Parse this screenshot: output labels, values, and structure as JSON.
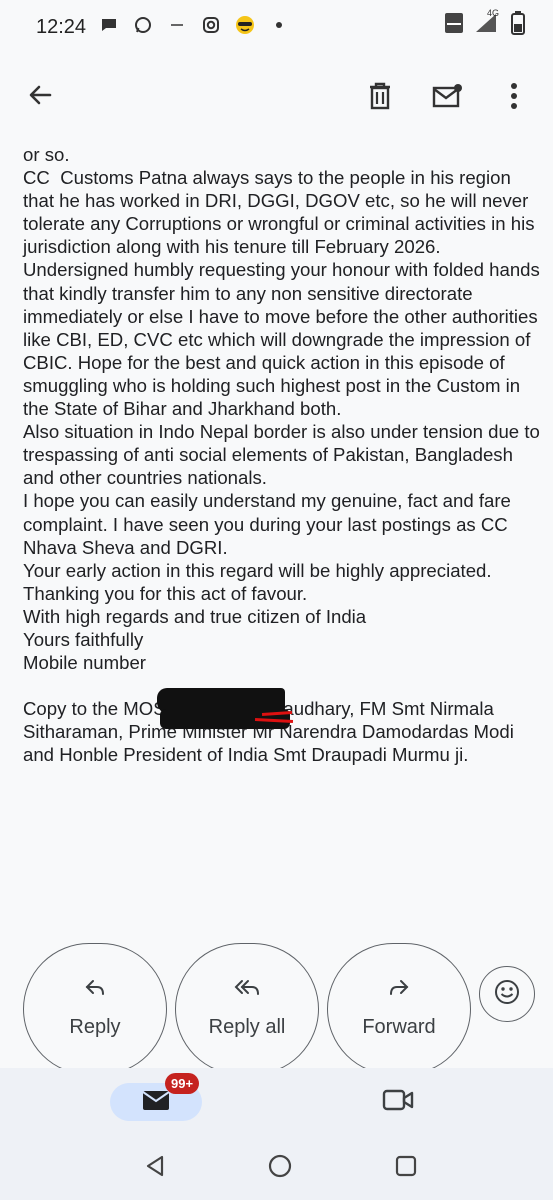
{
  "status_bar": {
    "time": "12:24",
    "left_icons": [
      "chat-bubble-icon",
      "whatsapp-icon",
      "dash-icon",
      "instagram-icon",
      "emoji-sunglasses-icon",
      "dot-icon"
    ],
    "right_icons": [
      "volte-icon",
      "signal-4g-icon",
      "battery-icon"
    ],
    "network_label": "4G"
  },
  "app_bar": {
    "icons": [
      "back-arrow-icon",
      "delete-icon",
      "mark-unread-icon",
      "more-vert-icon"
    ]
  },
  "email": {
    "lines": [
      "or so.",
      "CC  Customs Patna always says to the people in his region that he has worked in DRI, DGGI, DGOV etc, so he will never tolerate any Corruptions or wrongful or criminal activities in his jurisdiction along with his tenure till February 2026.",
      "Undersigned humbly requesting your honour with folded hands that kindly transfer him to any non sensitive directorate immediately or else I have to move before the other authorities like CBI, ED, CVC etc which will downgrade the impression of CBIC. Hope for the best and quick action in this episode of smuggling who is holding such highest post in the Custom in the State of Bihar and Jharkhand both.",
      "Also situation in Indo Nepal border is also under tension due to trespassing of anti social elements of Pakistan, Bangladesh and other countries nationals.",
      "I hope you can easily understand my genuine, fact and fare complaint. I have seen you during your last postings as CC Nhava Sheva and DGRI.",
      "Your early action in this regard will be highly appreciated.",
      "Thanking you for this act of favour.",
      "With high regards and true citizen of India",
      "Yours faithfully",
      "Mobile number",
      "",
      "Copy to the MOS Mr Pankaj Chaudhary, FM Smt Nirmala Sitharaman, Prime Minister Mr Narendra Damodardas Modi and Honble President of India Smt Draupadi Murmu ji."
    ]
  },
  "actions": {
    "reply": "Reply",
    "reply_all": "Reply all",
    "forward": "Forward"
  },
  "bottom_nav": {
    "mail_badge": "99+"
  },
  "colors": {
    "background": "#f8f9fa",
    "pill": "#d3e3fd",
    "badge": "#c5221f",
    "nav": "#eef1f6"
  }
}
